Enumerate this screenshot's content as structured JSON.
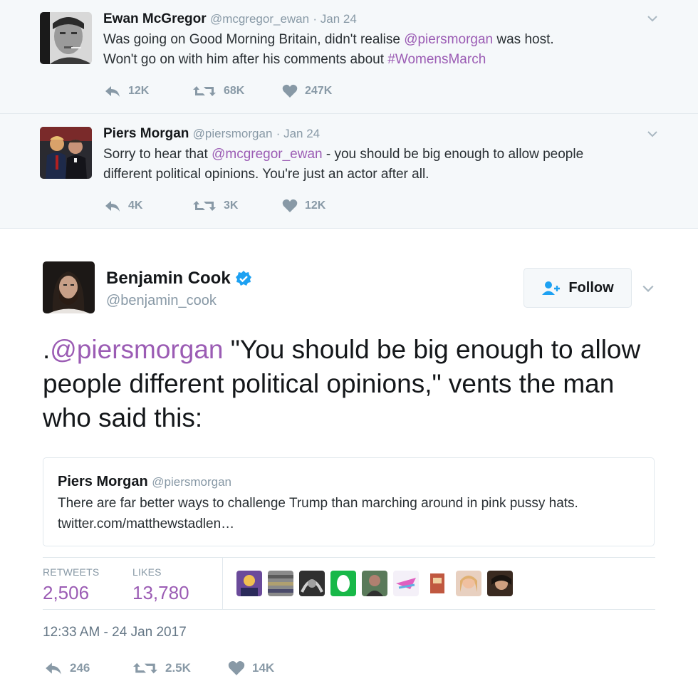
{
  "tweet1": {
    "name": "Ewan McGregor",
    "handle": "@mcgregor_ewan",
    "date": "· Jan 24",
    "line1_a": "Was going on Good Morning Britain, didn't realise ",
    "line1_mention": "@piersmorgan",
    "line1_b": " was host.",
    "line2_a": "Won't go on with him after his comments about ",
    "line2_hashtag": "#WomensMarch",
    "replies": "12K",
    "retweets": "68K",
    "likes": "247K"
  },
  "tweet2": {
    "name": "Piers Morgan",
    "handle": "@piersmorgan",
    "date": "· Jan 24",
    "line1_a": "Sorry to hear that ",
    "line1_mention": "@mcgregor_ewan",
    "line1_b": " - you should be big enough to allow people",
    "line2": "different political opinions. You're just an actor after all.",
    "replies": "4K",
    "retweets": "3K",
    "likes": "12K"
  },
  "main": {
    "name": "Benjamin Cook",
    "handle": "@benjamin_cook",
    "follow_label": "Follow",
    "text_prefix": ".",
    "text_mention": "@piersmorgan",
    "text_rest": " \"You should be big enough to allow people different political opinions,\" vents the man who said this:",
    "quote": {
      "name": "Piers Morgan",
      "handle": "@piersmorgan",
      "text": "There are far better ways to challenge Trump than marching around in pink pussy hats. twitter.com/matthewstadlen…"
    },
    "retweets_label": "RETWEETS",
    "retweets_count": "2,506",
    "likes_label": "LIKES",
    "likes_count": "13,780",
    "timestamp": "12:33 AM - 24 Jan 2017",
    "replies": "246",
    "retweets": "2.5K",
    "likes": "14K"
  },
  "colors": {
    "link": "#9b5cb4",
    "muted": "#8899a6",
    "verified": "#1da1f2",
    "context_bg": "#f5f8fa"
  }
}
